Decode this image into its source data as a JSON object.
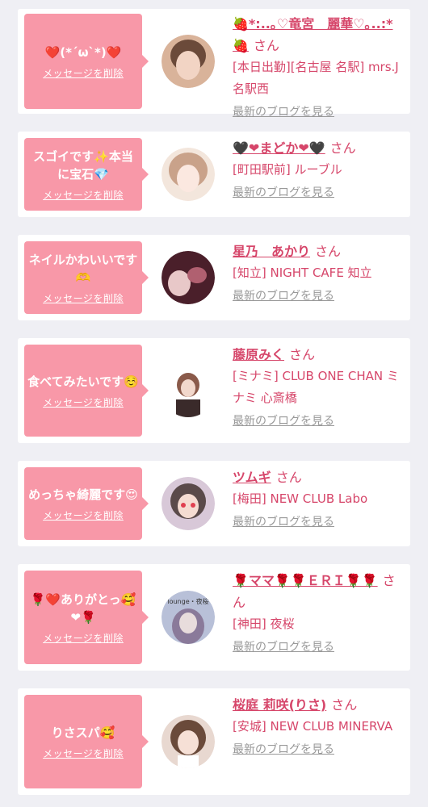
{
  "messages": [
    {
      "message": "❤️(*´ω`*)❤️",
      "delete_label": "メッセージを削除",
      "name": "🍓*:..｡♡竜宮　麗華♡｡..:*🍓",
      "suffix": "さん",
      "shop": "[本日出勤][名古屋 名駅] mrs.J 名駅西",
      "blog_label": "最新のブログを見る",
      "avatar_colors": [
        "#d9b39a",
        "#6b4a3a"
      ]
    },
    {
      "message": "スゴイです✨本当に宝石💎",
      "delete_label": "メッセージを削除",
      "name": "🖤❤まどか❤🖤",
      "suffix": "さん",
      "shop": "[町田駅前] ルーブル",
      "blog_label": "最新のブログを見る",
      "avatar_colors": [
        "#f3e6dc",
        "#c9a28a"
      ]
    },
    {
      "message": "ネイルかわいいです🫶",
      "delete_label": "メッセージを削除",
      "name": "星乃　あかり",
      "suffix": "さん",
      "shop": "[知立] NIGHT CAFE 知立",
      "blog_label": "最新のブログを見る",
      "avatar_colors": [
        "#4a1f2a",
        "#e8c8c8"
      ]
    },
    {
      "message": "食べてみたいです☺️",
      "delete_label": "メッセージを削除",
      "name": "藤原みく",
      "suffix": "さん",
      "shop": "[ミナミ] CLUB ONE CHAN ミナミ 心斎橋",
      "blog_label": "最新のブログを見る",
      "avatar_colors": [
        "#ffffff",
        "#3a2a2a"
      ]
    },
    {
      "message": "めっちゃ綺麗です😍",
      "delete_label": "メッセージを削除",
      "name": "ツムギ",
      "suffix": "さん",
      "shop": "[梅田] NEW CLUB Labo",
      "blog_label": "最新のブログを見る",
      "avatar_colors": [
        "#d8c8d8",
        "#5a4a4a"
      ]
    },
    {
      "message": "🌹❤️ありがとっ🥰❤🌹",
      "delete_label": "メッセージを削除",
      "name": "🌹ママ🌹🌹ＥＲＩ🌹🌹",
      "suffix": "さん",
      "shop": "[神田] 夜桜",
      "blog_label": "最新のブログを見る",
      "avatar_text": "lounge・夜桜",
      "avatar_colors": [
        "#b8c0d8",
        "#8a7a9a"
      ]
    },
    {
      "message": "りさスパ🥰",
      "delete_label": "メッセージを削除",
      "name": "桜庭 莉咲(りさ)",
      "suffix": "さん",
      "shop": "[安城] NEW CLUB MINERVA",
      "blog_label": "最新のブログを見る",
      "avatar_colors": [
        "#e8d8d0",
        "#6a4a3a"
      ]
    }
  ]
}
